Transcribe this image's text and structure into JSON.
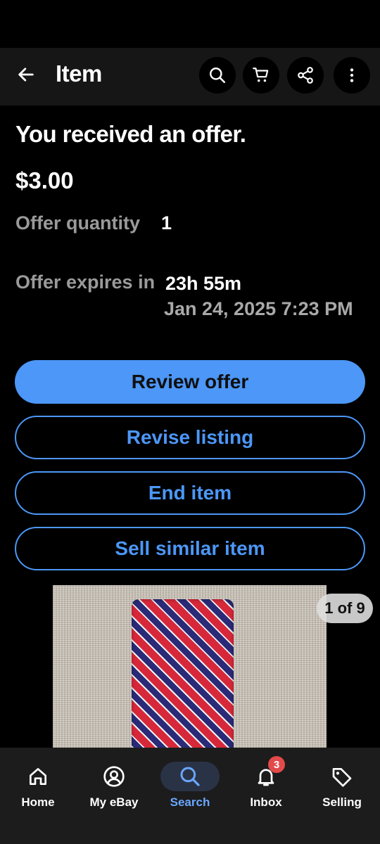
{
  "appbar": {
    "title": "Item"
  },
  "offer": {
    "headline": "You received an offer.",
    "price": "$3.00",
    "quantity_label": "Offer quantity",
    "quantity_value": "1",
    "expires_label": "Offer expires in",
    "expires_value": "23h 55m",
    "expires_date": "Jan 24, 2025 7:23 PM"
  },
  "actions": {
    "review": "Review offer",
    "revise": "Revise listing",
    "end": "End item",
    "sell_similar": "Sell similar item"
  },
  "gallery": {
    "counter": "1 of 9"
  },
  "bottom_nav": {
    "home": "Home",
    "myebay": "My eBay",
    "search": "Search",
    "inbox": "Inbox",
    "inbox_badge": "3",
    "selling": "Selling"
  },
  "colors": {
    "accent": "#4c97f7",
    "badge": "#e34a4a"
  }
}
